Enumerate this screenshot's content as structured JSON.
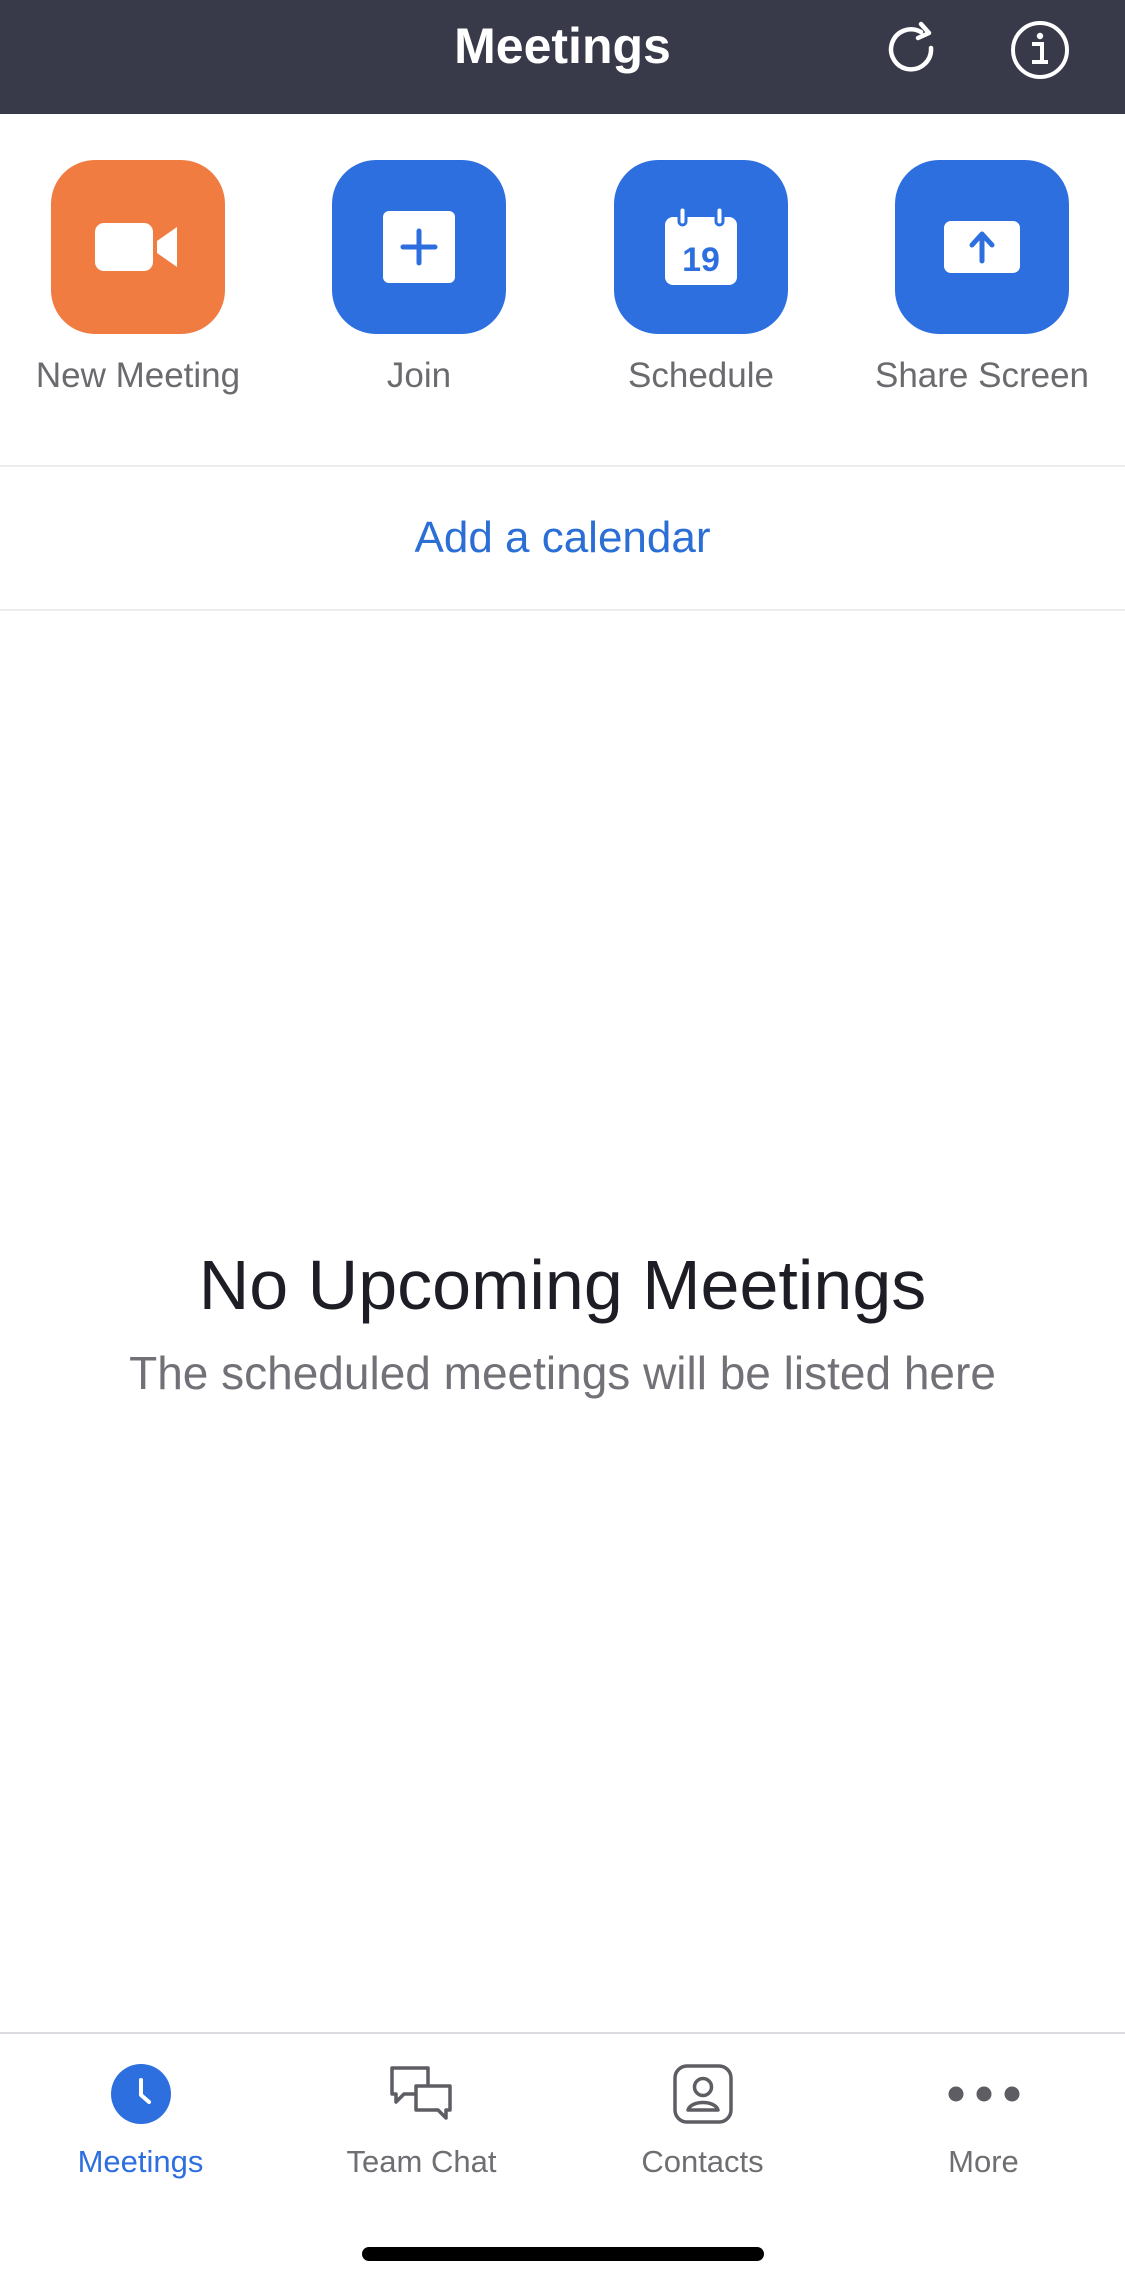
{
  "header": {
    "title": "Meetings",
    "refresh_icon": "refresh-icon",
    "info_icon": "info-icon"
  },
  "actions": [
    {
      "label": "New Meeting",
      "icon": "video-camera-icon",
      "color": "#f07c42"
    },
    {
      "label": "Join",
      "icon": "plus-icon",
      "color": "#2e6fe0"
    },
    {
      "label": "Schedule",
      "icon": "calendar-icon",
      "color": "#2e6fe0",
      "calendar_day": "19"
    },
    {
      "label": "Share Screen",
      "icon": "share-upload-icon",
      "color": "#2e6fe0"
    }
  ],
  "calendar_link": "Add a calendar",
  "empty_state": {
    "title": "No Upcoming Meetings",
    "subtitle": "The scheduled meetings will be listed here"
  },
  "tabs": [
    {
      "label": "Meetings",
      "icon": "clock-icon",
      "active": true
    },
    {
      "label": "Team Chat",
      "icon": "chat-bubbles-icon",
      "active": false
    },
    {
      "label": "Contacts",
      "icon": "contact-card-icon",
      "active": false
    },
    {
      "label": "More",
      "icon": "ellipsis-icon",
      "active": false
    }
  ],
  "colors": {
    "header_bg": "#393a49",
    "accent_blue": "#2e6fe0",
    "accent_orange": "#f07c42",
    "link_blue": "#2b6fd6"
  }
}
